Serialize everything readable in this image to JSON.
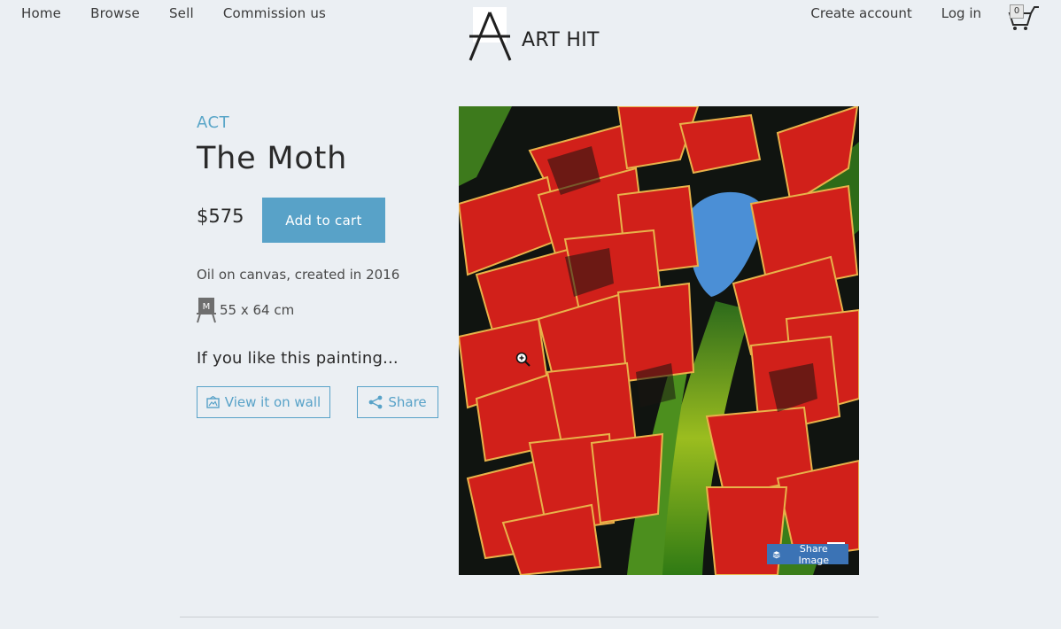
{
  "nav": {
    "left": [
      "Home",
      "Browse",
      "Sell",
      "Commission us"
    ],
    "right": [
      "Create account",
      "Log in"
    ],
    "cart_count": "0"
  },
  "logo": {
    "text": "ART HIT",
    "icon": "logo-a-icon"
  },
  "artwork": {
    "artist": "ACT",
    "title": "The Moth",
    "price": "$575",
    "add_to_cart": "Add to cart",
    "medium": "Oil on canvas, created in 2016",
    "size_badge": "M",
    "size": "55 x 64 cm",
    "like_heading": "If you like this painting...",
    "view_wall": "View it on wall",
    "share": "Share",
    "share_image": "Share Image"
  },
  "colors": {
    "accent": "#58a2c8",
    "background": "#ebeff3",
    "share_image_bg": "#3b73b5"
  }
}
